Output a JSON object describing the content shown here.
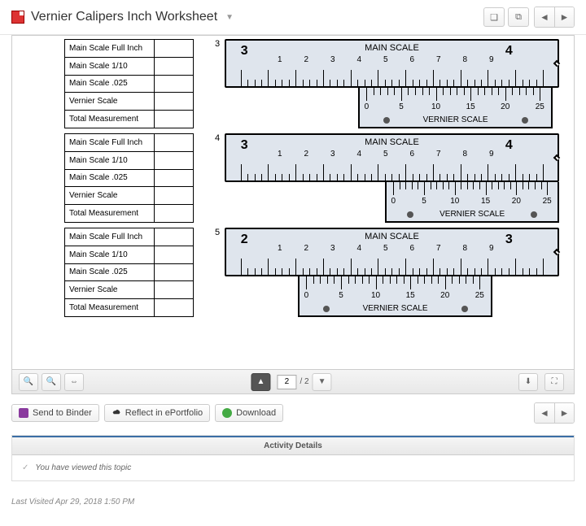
{
  "header": {
    "title": "Vernier Calipers Inch Worksheet"
  },
  "worksheet": {
    "table_rows": [
      "Main Scale Full Inch",
      "Main Scale 1/10",
      "Main Scale .025",
      "Vernier Scale",
      "Total Measurement"
    ],
    "main_scale_label": "MAIN SCALE",
    "vernier_scale_label": "VERNIER SCALE",
    "problems": [
      {
        "num": "3",
        "main_left": "3",
        "main_right": "4",
        "vernier_offset_pct": 40,
        "vernier_width_pct": 58
      },
      {
        "num": "4",
        "main_left": "3",
        "main_right": "4",
        "vernier_offset_pct": 48,
        "vernier_width_pct": 52
      },
      {
        "num": "5",
        "main_left": "2",
        "main_right": "3",
        "vernier_offset_pct": 22,
        "vernier_width_pct": 58
      }
    ],
    "main_minor_labels": [
      "1",
      "2",
      "3",
      "4",
      "5",
      "6",
      "7",
      "8",
      "9"
    ],
    "vernier_labels": [
      "0",
      "5",
      "10",
      "15",
      "20",
      "25"
    ]
  },
  "pager": {
    "current": "2",
    "total": "/ 2"
  },
  "actions": {
    "binder": "Send to Binder",
    "reflect": "Reflect in ePortfolio",
    "download": "Download"
  },
  "details": {
    "heading": "Activity Details",
    "viewed": "You have viewed this topic"
  },
  "footer": {
    "last_visited_label": "Last Visited ",
    "last_visited_value": "Apr 29, 2018 1:50 PM"
  }
}
